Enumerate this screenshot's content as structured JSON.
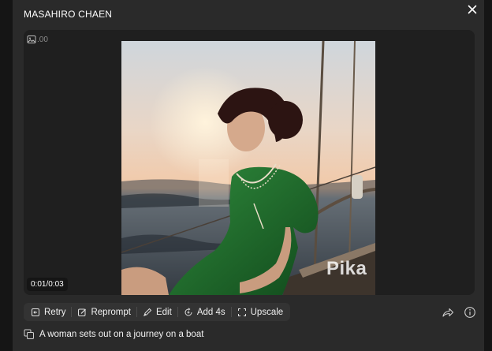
{
  "modal": {
    "title": "MASAHIRO CHAEN"
  },
  "player": {
    "badge_text": ".00",
    "timecode": "0:01/0:03",
    "watermark": "Pika"
  },
  "toolbar": {
    "retry": "Retry",
    "reprompt": "Reprompt",
    "edit": "Edit",
    "add": "Add 4s",
    "upscale": "Upscale"
  },
  "prompt": {
    "text": "A woman sets out on a journey on a boat"
  },
  "icons": [
    "close-icon",
    "image-icon",
    "retry-icon",
    "reprompt-icon",
    "edit-icon",
    "add-time-icon",
    "upscale-icon",
    "share-icon",
    "info-icon",
    "copy-icon"
  ],
  "colors": {
    "modal_bg": "#2a2a2a",
    "player_bg": "#1f1f1f",
    "toolbar_bg": "#333333",
    "text": "#f2f2f2"
  }
}
